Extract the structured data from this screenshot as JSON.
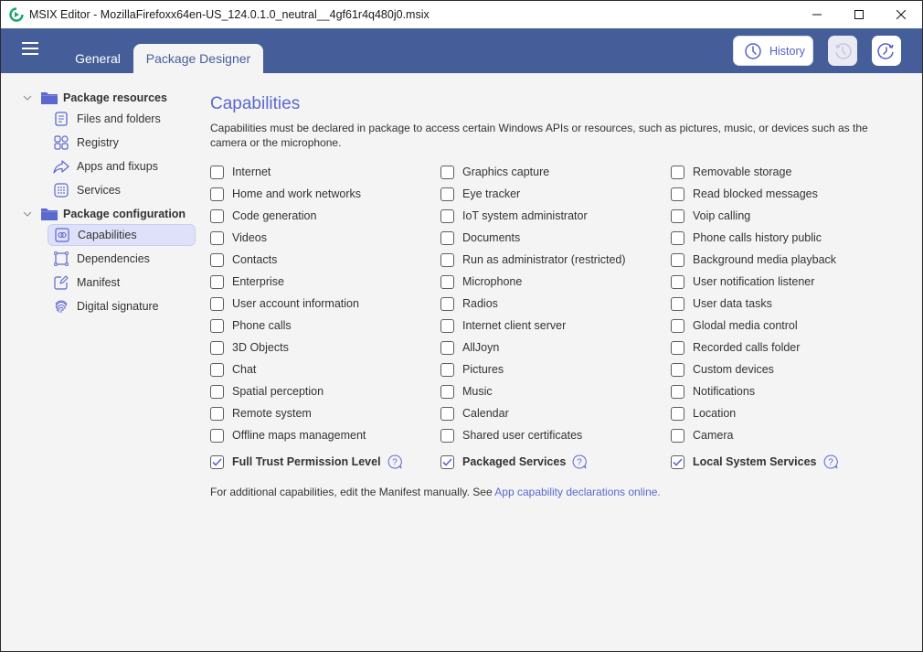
{
  "window": {
    "title": "MSIX Editor - MozillaFirefoxx64en-US_124.0.1.0_neutral__4gf61r4q480j0.msix",
    "app_icon": "msix-editor-logo-icon",
    "controls": {
      "minimize": "minimize-icon",
      "maximize": "maximize-icon",
      "close": "close-icon"
    }
  },
  "header": {
    "menu_icon": "hamburger-menu-icon",
    "tabs": [
      {
        "label": "General",
        "active": false
      },
      {
        "label": "Package Designer",
        "active": true
      }
    ],
    "history_button": {
      "label": "History",
      "icon": "clock-icon"
    },
    "undo_button": {
      "icon": "undo-history-icon",
      "enabled": false
    },
    "redo_button": {
      "icon": "redo-history-icon",
      "enabled": true
    }
  },
  "sidebar": {
    "groups": [
      {
        "label": "Package resources",
        "expanded": true,
        "items": [
          {
            "label": "Files and folders",
            "icon": "document-icon"
          },
          {
            "label": "Registry",
            "icon": "registry-icon"
          },
          {
            "label": "Apps and fixups",
            "icon": "share-arrow-icon"
          },
          {
            "label": "Services",
            "icon": "services-grid-icon"
          }
        ]
      },
      {
        "label": "Package configuration",
        "expanded": true,
        "items": [
          {
            "label": "Capabilities",
            "icon": "capabilities-icon",
            "active": true
          },
          {
            "label": "Dependencies",
            "icon": "dependencies-icon"
          },
          {
            "label": "Manifest",
            "icon": "manifest-edit-icon"
          },
          {
            "label": "Digital signature",
            "icon": "fingerprint-icon"
          }
        ]
      }
    ]
  },
  "main": {
    "title": "Capabilities",
    "description": "Capabilities must be declared in package to access certain Windows APIs or resources, such as pictures, music, or devices such as the camera or the microphone.",
    "columns": [
      [
        {
          "label": "Internet",
          "checked": false
        },
        {
          "label": "Home and work networks",
          "checked": false
        },
        {
          "label": "Code generation",
          "checked": false
        },
        {
          "label": "Videos",
          "checked": false
        },
        {
          "label": "Contacts",
          "checked": false
        },
        {
          "label": "Enterprise",
          "checked": false
        },
        {
          "label": "User account information",
          "checked": false
        },
        {
          "label": "Phone calls",
          "checked": false
        },
        {
          "label": "3D Objects",
          "checked": false
        },
        {
          "label": "Chat",
          "checked": false
        },
        {
          "label": "Spatial perception",
          "checked": false
        },
        {
          "label": "Remote system",
          "checked": false
        },
        {
          "label": "Offline maps management",
          "checked": false
        }
      ],
      [
        {
          "label": "Graphics capture",
          "checked": false
        },
        {
          "label": "Eye tracker",
          "checked": false
        },
        {
          "label": "IoT system administrator",
          "checked": false
        },
        {
          "label": "Documents",
          "checked": false
        },
        {
          "label": "Run as administrator (restricted)",
          "checked": false
        },
        {
          "label": "Microphone",
          "checked": false
        },
        {
          "label": "Radios",
          "checked": false
        },
        {
          "label": "Internet client server",
          "checked": false
        },
        {
          "label": "AllJoyn",
          "checked": false
        },
        {
          "label": "Pictures",
          "checked": false
        },
        {
          "label": "Music",
          "checked": false
        },
        {
          "label": "Calendar",
          "checked": false
        },
        {
          "label": "Shared user certificates",
          "checked": false
        }
      ],
      [
        {
          "label": "Removable storage",
          "checked": false
        },
        {
          "label": "Read blocked messages",
          "checked": false
        },
        {
          "label": "Voip calling",
          "checked": false
        },
        {
          "label": "Phone calls history public",
          "checked": false
        },
        {
          "label": "Background media playback",
          "checked": false
        },
        {
          "label": "User notification listener",
          "checked": false
        },
        {
          "label": "User data tasks",
          "checked": false
        },
        {
          "label": "Glodal media control",
          "checked": false
        },
        {
          "label": "Recorded calls folder",
          "checked": false
        },
        {
          "label": "Custom devices",
          "checked": false
        },
        {
          "label": "Notifications",
          "checked": false
        },
        {
          "label": "Location",
          "checked": false
        },
        {
          "label": "Camera",
          "checked": false
        }
      ]
    ],
    "special": [
      {
        "label": "Full Trust Permission Level",
        "checked": true,
        "help_icon": "help-question-icon"
      },
      {
        "label": "Packaged Services",
        "checked": true,
        "help_icon": "help-question-icon"
      },
      {
        "label": "Local System Services",
        "checked": true,
        "help_icon": "help-question-icon"
      }
    ],
    "footer": {
      "text": "For additional capabilities, edit the Manifest manually. See ",
      "link_text": "App capability declarations online."
    }
  },
  "colors": {
    "header_bg": "#455e9a",
    "accent": "#5a68cf",
    "active_nav_bg": "#dfe1fb",
    "app_icon_green": "#1aa56b",
    "content_bg": "#f4f4f4"
  }
}
